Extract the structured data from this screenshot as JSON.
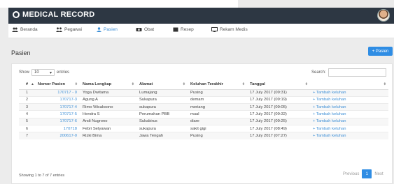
{
  "app": {
    "title": "MEDICAL RECORD"
  },
  "nav": [
    {
      "key": "beranda",
      "label": "Beranda",
      "icon": "group-icon",
      "active": false
    },
    {
      "key": "pegawai",
      "label": "Pegawai",
      "icon": "staff-icon",
      "active": false
    },
    {
      "key": "pasien",
      "label": "Pasien",
      "icon": "user-icon",
      "active": true
    },
    {
      "key": "obat",
      "label": "Obat",
      "icon": "medicine-icon",
      "active": false
    },
    {
      "key": "resep",
      "label": "Resep",
      "icon": "prescription-icon",
      "active": false
    },
    {
      "key": "rekam-medis",
      "label": "Rekam Medis",
      "icon": "monitor-icon",
      "active": false
    }
  ],
  "page": {
    "title": "Pasien",
    "add_button": "+ Pasien"
  },
  "table_controls": {
    "show_label": "Show",
    "entries_value": "10",
    "entries_label": "entries",
    "search_label": "Search:",
    "search_value": ""
  },
  "table": {
    "headers": [
      "#",
      "Nomor Pasien",
      "Nama Lengkap",
      "Alamat",
      "Keluhan Terakhir",
      "Tanggal",
      ""
    ],
    "rows": [
      {
        "no": "1",
        "nomor": "170717 - 0",
        "nama": "Yoga Dwitama",
        "alamat": "Lumajang",
        "keluhan": "Pusing",
        "tanggal": "17 July 2017 (09:31)",
        "aksi": "+ Tambah keluhan"
      },
      {
        "no": "2",
        "nomor": "170717-3",
        "nama": "Agung A",
        "alamat": "Sukapura",
        "keluhan": "demam",
        "tanggal": "17 July 2017 (09:19)",
        "aksi": "+ Tambah keluhan"
      },
      {
        "no": "3",
        "nomor": "170717-4",
        "nama": "Rimo Wicaksono",
        "alamat": "sukapura",
        "keluhan": "meriang",
        "tanggal": "17 July 2017 (09:05)",
        "aksi": "+ Tambah keluhan"
      },
      {
        "no": "4",
        "nomor": "170717-5",
        "nama": "Hendra S",
        "alamat": "Perumahan PBB",
        "keluhan": "mual",
        "tanggal": "17 July 2017 (09:32)",
        "aksi": "+ Tambah keluhan"
      },
      {
        "no": "5",
        "nomor": "170717-6",
        "nama": "Andi Nugrono",
        "alamat": "Sukabirus",
        "keluhan": "diare",
        "tanggal": "17 July 2017 (09:25)",
        "aksi": "+ Tambah keluhan"
      },
      {
        "no": "6",
        "nomor": "170718",
        "nama": "Febri Setyawan",
        "alamat": "sukapura",
        "keluhan": "sakit gigi",
        "tanggal": "17 July 2017 (08:49)",
        "aksi": "+ Tambah keluhan"
      },
      {
        "no": "7",
        "nomor": "200617-0",
        "nama": "Rizki Bima",
        "alamat": "Jawa Tengah",
        "keluhan": "Pusing",
        "tanggal": "17 July 2017 (07:27)",
        "aksi": "+ Tambah keluhan"
      }
    ]
  },
  "footer": {
    "info": "Showing 1 to 7 of 7 entries",
    "previous": "Previous",
    "current_page": "1",
    "next": "Next"
  },
  "colors": {
    "accent": "#2f8de4",
    "navbar": "#2d3743",
    "link": "#3d8fd6"
  }
}
